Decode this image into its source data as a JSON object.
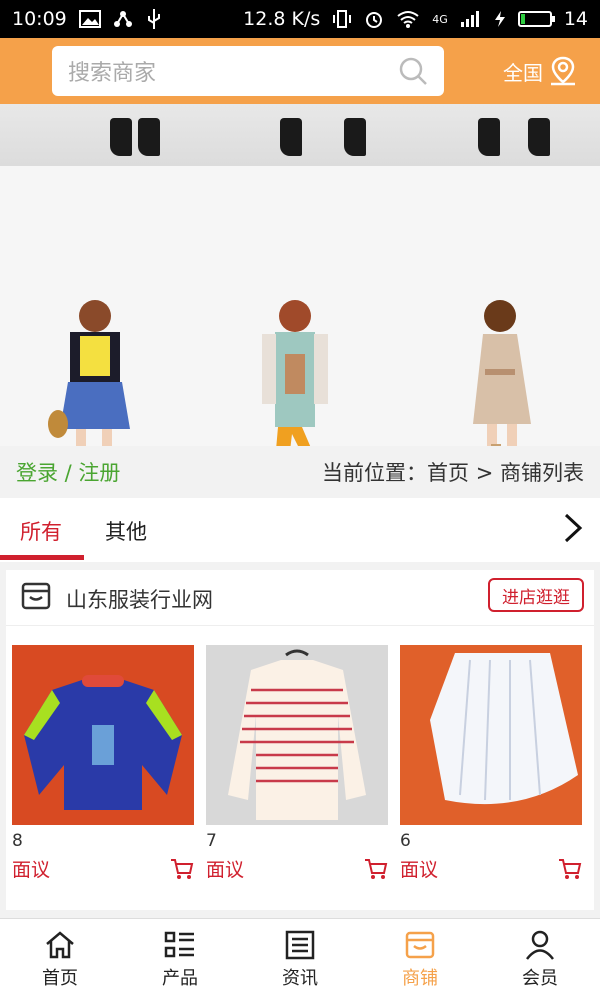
{
  "statusbar": {
    "time": "10:09",
    "network_speed": "12.8 K/s",
    "signal_label": "4G",
    "battery": "14",
    "battery_level_percent": 14
  },
  "header": {
    "search_placeholder": "搜索商家",
    "region_label": "全国",
    "bg_color": "#f5a14a"
  },
  "loginbar": {
    "login_text": "登录 / 注册",
    "breadcrumb": "当前位置：首页 > 商铺列表"
  },
  "tabs": [
    {
      "label": "所有",
      "active": true
    },
    {
      "label": "其他",
      "active": false
    }
  ],
  "shop": {
    "name": "山东服装行业网",
    "visit_button": "进店逛逛",
    "products": [
      {
        "number": "8",
        "price": "面议"
      },
      {
        "number": "7",
        "price": "面议"
      },
      {
        "number": "6",
        "price": "面议"
      }
    ]
  },
  "bottom_nav": [
    {
      "label": "首页",
      "icon": "home-icon",
      "active": false
    },
    {
      "label": "产品",
      "icon": "list-icon",
      "active": false
    },
    {
      "label": "资讯",
      "icon": "news-icon",
      "active": false
    },
    {
      "label": "商铺",
      "icon": "shop-icon",
      "active": true
    },
    {
      "label": "会员",
      "icon": "user-icon",
      "active": false
    }
  ],
  "colors": {
    "accent": "#f5a14a",
    "red": "#d0202e",
    "green": "#4aa531"
  }
}
